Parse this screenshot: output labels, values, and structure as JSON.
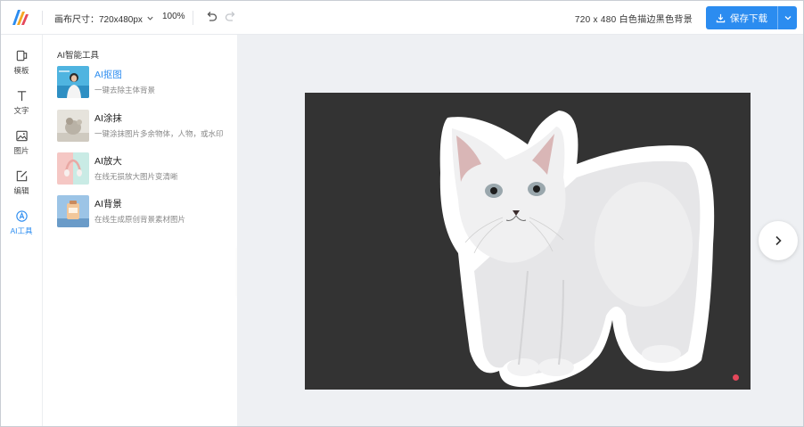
{
  "header": {
    "canvas_size_label": "画布尺寸：720x480px",
    "zoom": "100%",
    "doc_title": "720 x 480 白色描边黑色背景",
    "save_label": "保存下载"
  },
  "sidebar": {
    "items": [
      {
        "label": "模板",
        "icon": "template-icon"
      },
      {
        "label": "文字",
        "icon": "text-icon"
      },
      {
        "label": "图片",
        "icon": "image-icon"
      },
      {
        "label": "编辑",
        "icon": "edit-icon"
      },
      {
        "label": "AI工具",
        "icon": "ai-tools-icon",
        "active": true
      }
    ]
  },
  "panel": {
    "title": "AI智能工具",
    "tools": [
      {
        "name": "AI抠图",
        "desc": "一键去除主体背景",
        "active": true
      },
      {
        "name": "AI涂抹",
        "desc": "一键涂抹图片多余物体，人物，或水印"
      },
      {
        "name": "AI放大",
        "desc": "在线无损放大图片变清晰"
      },
      {
        "name": "AI背景",
        "desc": "在线生成原创背景素材图片"
      }
    ]
  },
  "colors": {
    "accent": "#2b8cf0",
    "canvas_bg": "#333333",
    "workspace_bg": "#eef0f3"
  }
}
